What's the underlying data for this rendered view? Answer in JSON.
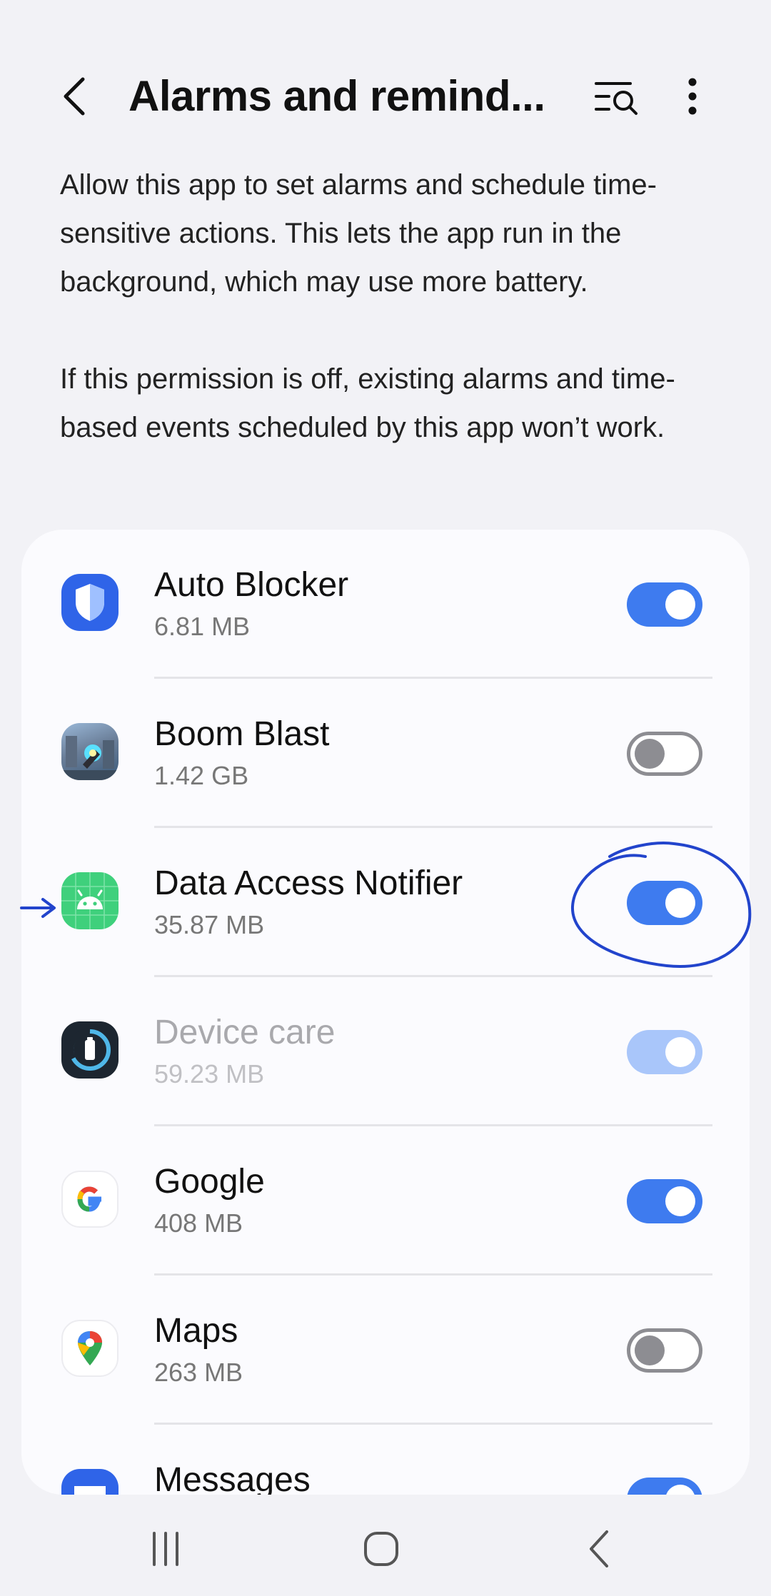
{
  "header": {
    "title": "Alarms and remind...",
    "back_icon": "chevron-left-icon",
    "search_icon": "list-search-icon",
    "more_icon": "more-vertical-icon"
  },
  "description": {
    "paragraph1": "Allow this app to set alarms and schedule time-sensitive actions. This lets the app run in the background, which may use more battery.",
    "paragraph2": "If this permission is off, existing alarms and time-based events scheduled by this app won’t work."
  },
  "apps": [
    {
      "name": "Auto Blocker",
      "size": "6.81 MB",
      "enabled": true,
      "disabled": false,
      "icon": "shield-icon"
    },
    {
      "name": "Boom Blast",
      "size": "1.42 GB",
      "enabled": false,
      "disabled": false,
      "icon": "game-icon"
    },
    {
      "name": "Data Access Notifier",
      "size": "35.87 MB",
      "enabled": true,
      "disabled": false,
      "icon": "android-icon"
    },
    {
      "name": "Device care",
      "size": "59.23 MB",
      "enabled": true,
      "disabled": true,
      "icon": "device-care-icon"
    },
    {
      "name": "Google",
      "size": "408 MB",
      "enabled": true,
      "disabled": false,
      "icon": "google-icon"
    },
    {
      "name": "Maps",
      "size": "263 MB",
      "enabled": false,
      "disabled": false,
      "icon": "maps-icon"
    },
    {
      "name": "Messages",
      "size": "",
      "enabled": true,
      "disabled": false,
      "icon": "messages-icon"
    }
  ],
  "colors": {
    "accent": "#3e7bef",
    "annotation": "#2244cc",
    "background": "#f2f2f6"
  },
  "navbar": {
    "recents_icon": "recents-icon",
    "home_icon": "home-icon",
    "back_icon": "back-icon"
  }
}
